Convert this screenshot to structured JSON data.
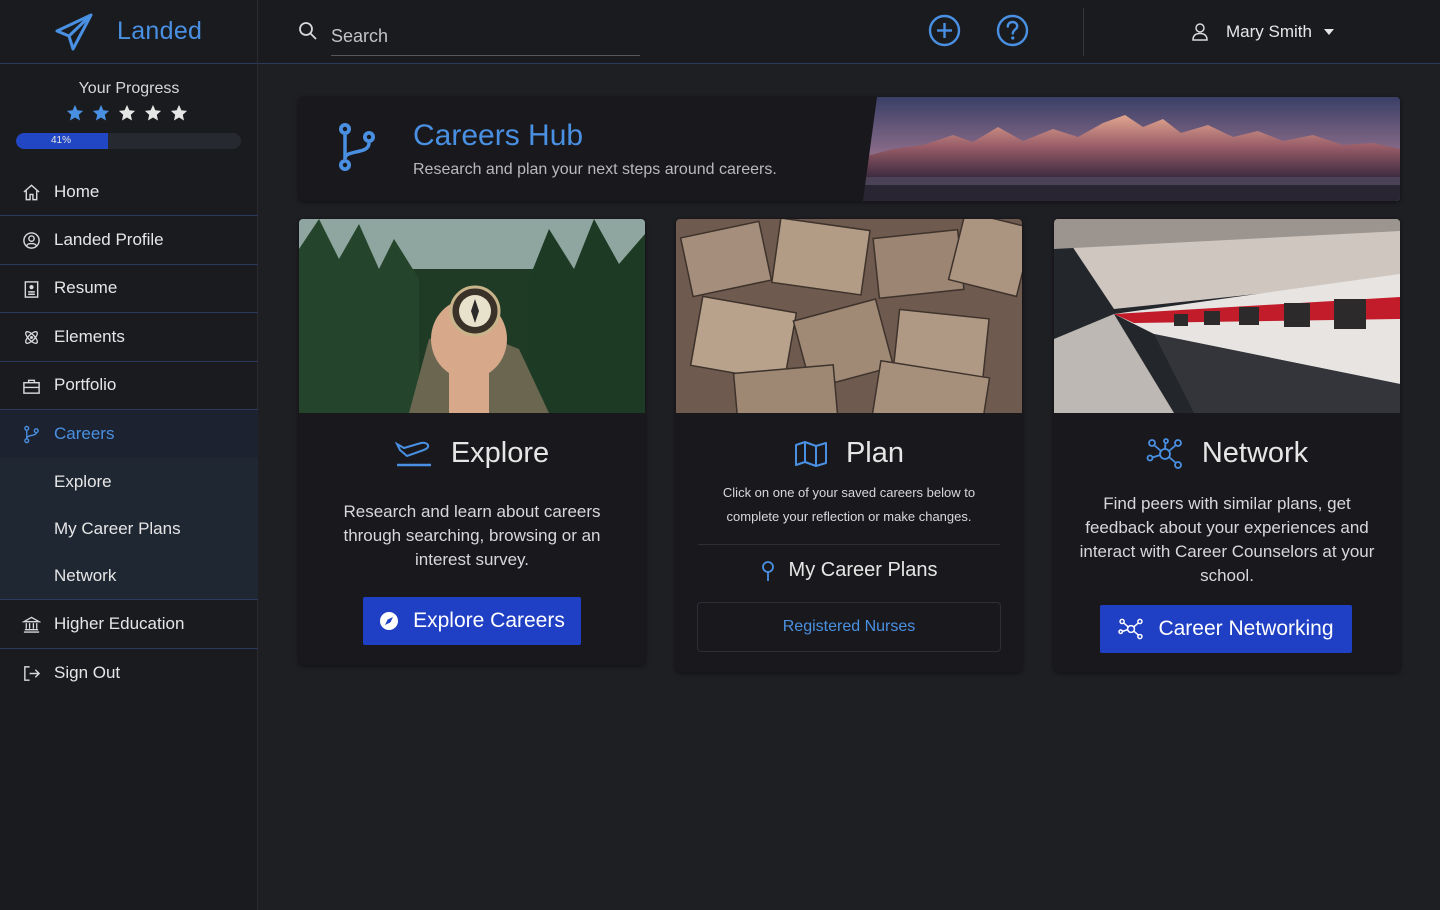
{
  "brand": {
    "name": "Landed"
  },
  "search": {
    "placeholder": "Search"
  },
  "user": {
    "name": "Mary Smith"
  },
  "progress": {
    "label": "Your Progress",
    "percent_text": "41%",
    "percent": 41,
    "stars_filled": 2,
    "stars_total": 5
  },
  "sidebar": {
    "items": [
      {
        "label": "Home",
        "icon": "home-icon"
      },
      {
        "label": "Landed Profile",
        "icon": "profile-icon"
      },
      {
        "label": "Resume",
        "icon": "resume-icon"
      },
      {
        "label": "Elements",
        "icon": "elements-icon"
      },
      {
        "label": "Portfolio",
        "icon": "portfolio-icon"
      },
      {
        "label": "Careers",
        "icon": "branch-icon"
      },
      {
        "label": "Higher Education",
        "icon": "institution-icon"
      },
      {
        "label": "Sign Out",
        "icon": "sign-out-icon"
      }
    ],
    "careers_sub": [
      {
        "label": "Explore"
      },
      {
        "label": "My Career Plans"
      },
      {
        "label": "Network"
      }
    ]
  },
  "hub": {
    "title": "Careers Hub",
    "subtitle": "Research and plan your next steps around careers."
  },
  "cards": {
    "explore": {
      "title": "Explore",
      "description": "Research and learn about careers through searching, browsing or an interest survey.",
      "button": "Explore Careers"
    },
    "plan": {
      "title": "Plan",
      "description": "Click on one of your saved careers below to complete your reflection or make changes.",
      "plans_title": "My Career Plans",
      "plan_item": "Registered Nurses"
    },
    "network": {
      "title": "Network",
      "description": "Find peers with similar plans, get feedback about your experiences and interact with Career Counselors at your school.",
      "button": "Career Networking"
    }
  },
  "colors": {
    "accent": "#4a90e2",
    "button": "#1f3fc4",
    "background": "#1e1f23",
    "panel": "#19191d"
  }
}
